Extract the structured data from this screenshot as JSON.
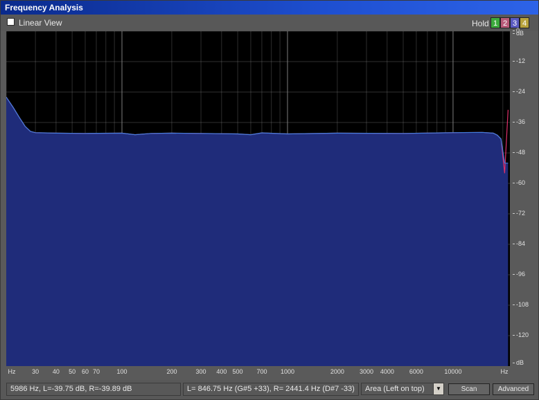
{
  "window": {
    "title": "Frequency Analysis"
  },
  "toolbar": {
    "linear_view_label": "Linear View",
    "linear_view_checked": false,
    "hold_label": "Hold",
    "hold_buttons": [
      {
        "label": "1",
        "color": "#3caa3c"
      },
      {
        "label": "2",
        "color": "#b85a78"
      },
      {
        "label": "3",
        "color": "#5a5ac0"
      },
      {
        "label": "4",
        "color": "#b8a23c"
      }
    ]
  },
  "chart_data": {
    "type": "area",
    "x_scale": "log",
    "x_unit_label": "Hz",
    "xlim": [
      20,
      22050
    ],
    "x_ticks": [
      {
        "value": 30,
        "label": "30"
      },
      {
        "value": 40,
        "label": "40"
      },
      {
        "value": 50,
        "label": "50"
      },
      {
        "value": 60,
        "label": "60"
      },
      {
        "value": 70,
        "label": "70"
      },
      {
        "value": 100,
        "label": "100"
      },
      {
        "value": 200,
        "label": "200"
      },
      {
        "value": 300,
        "label": "300"
      },
      {
        "value": 400,
        "label": "400"
      },
      {
        "value": 500,
        "label": "500"
      },
      {
        "value": 700,
        "label": "700"
      },
      {
        "value": 1000,
        "label": "1000"
      },
      {
        "value": 2000,
        "label": "2000"
      },
      {
        "value": 3000,
        "label": "3000"
      },
      {
        "value": 4000,
        "label": "4000"
      },
      {
        "value": 6000,
        "label": "6000"
      },
      {
        "value": 10000,
        "label": "10000"
      }
    ],
    "y_unit_label": "dB",
    "ylim": [
      -132,
      0
    ],
    "y_ticks": [
      0,
      -12,
      -24,
      -36,
      -48,
      -60,
      -72,
      -84,
      -96,
      -108,
      -120
    ],
    "grid": true,
    "series": [
      {
        "color": "#e0306a",
        "x": [
          20,
          22,
          24,
          26,
          28,
          30,
          40,
          60,
          100,
          120,
          150,
          200,
          300,
          500,
          600,
          700,
          1000,
          2000,
          5000,
          10000,
          15000,
          17500,
          18500,
          19500,
          20500,
          21500
        ],
        "y": [
          -26,
          -30,
          -34,
          -37.5,
          -39.5,
          -40,
          -40.2,
          -40.3,
          -40.2,
          -40.8,
          -40.3,
          -40.2,
          -40.3,
          -40.5,
          -40.8,
          -40.1,
          -40.5,
          -40.2,
          -40.3,
          -40.0,
          -39.9,
          -40.2,
          -41.0,
          -42.5,
          -56,
          -31
        ]
      },
      {
        "color": "#3f7fe0",
        "x": [
          20,
          22,
          24,
          26,
          28,
          30,
          40,
          60,
          100,
          120,
          150,
          200,
          300,
          500,
          600,
          700,
          1000,
          2000,
          5000,
          10000,
          15000,
          17500,
          18500,
          19500,
          20500,
          21500
        ],
        "y": [
          -26,
          -30,
          -34,
          -37.5,
          -39.5,
          -40,
          -40.2,
          -40.3,
          -40.2,
          -40.8,
          -40.3,
          -40.2,
          -40.3,
          -40.5,
          -40.8,
          -40.1,
          -40.5,
          -40.2,
          -40.3,
          -40.0,
          -39.9,
          -40.2,
          -41.0,
          -42.5,
          -52,
          -52
        ]
      }
    ],
    "fill_color": "#1f2c7a",
    "grid_color": "#8a8a8a"
  },
  "status": {
    "cursor_readout": "5986 Hz, L=-39.75 dB, R=-39.89 dB",
    "peak_readout": "L= 846.75 Hz (G#5 +33), R= 2441.4 Hz (D#7 -33)",
    "mode_select": "Area (Left on top)",
    "scan_label": "Scan",
    "advanced_label": "Advanced"
  }
}
